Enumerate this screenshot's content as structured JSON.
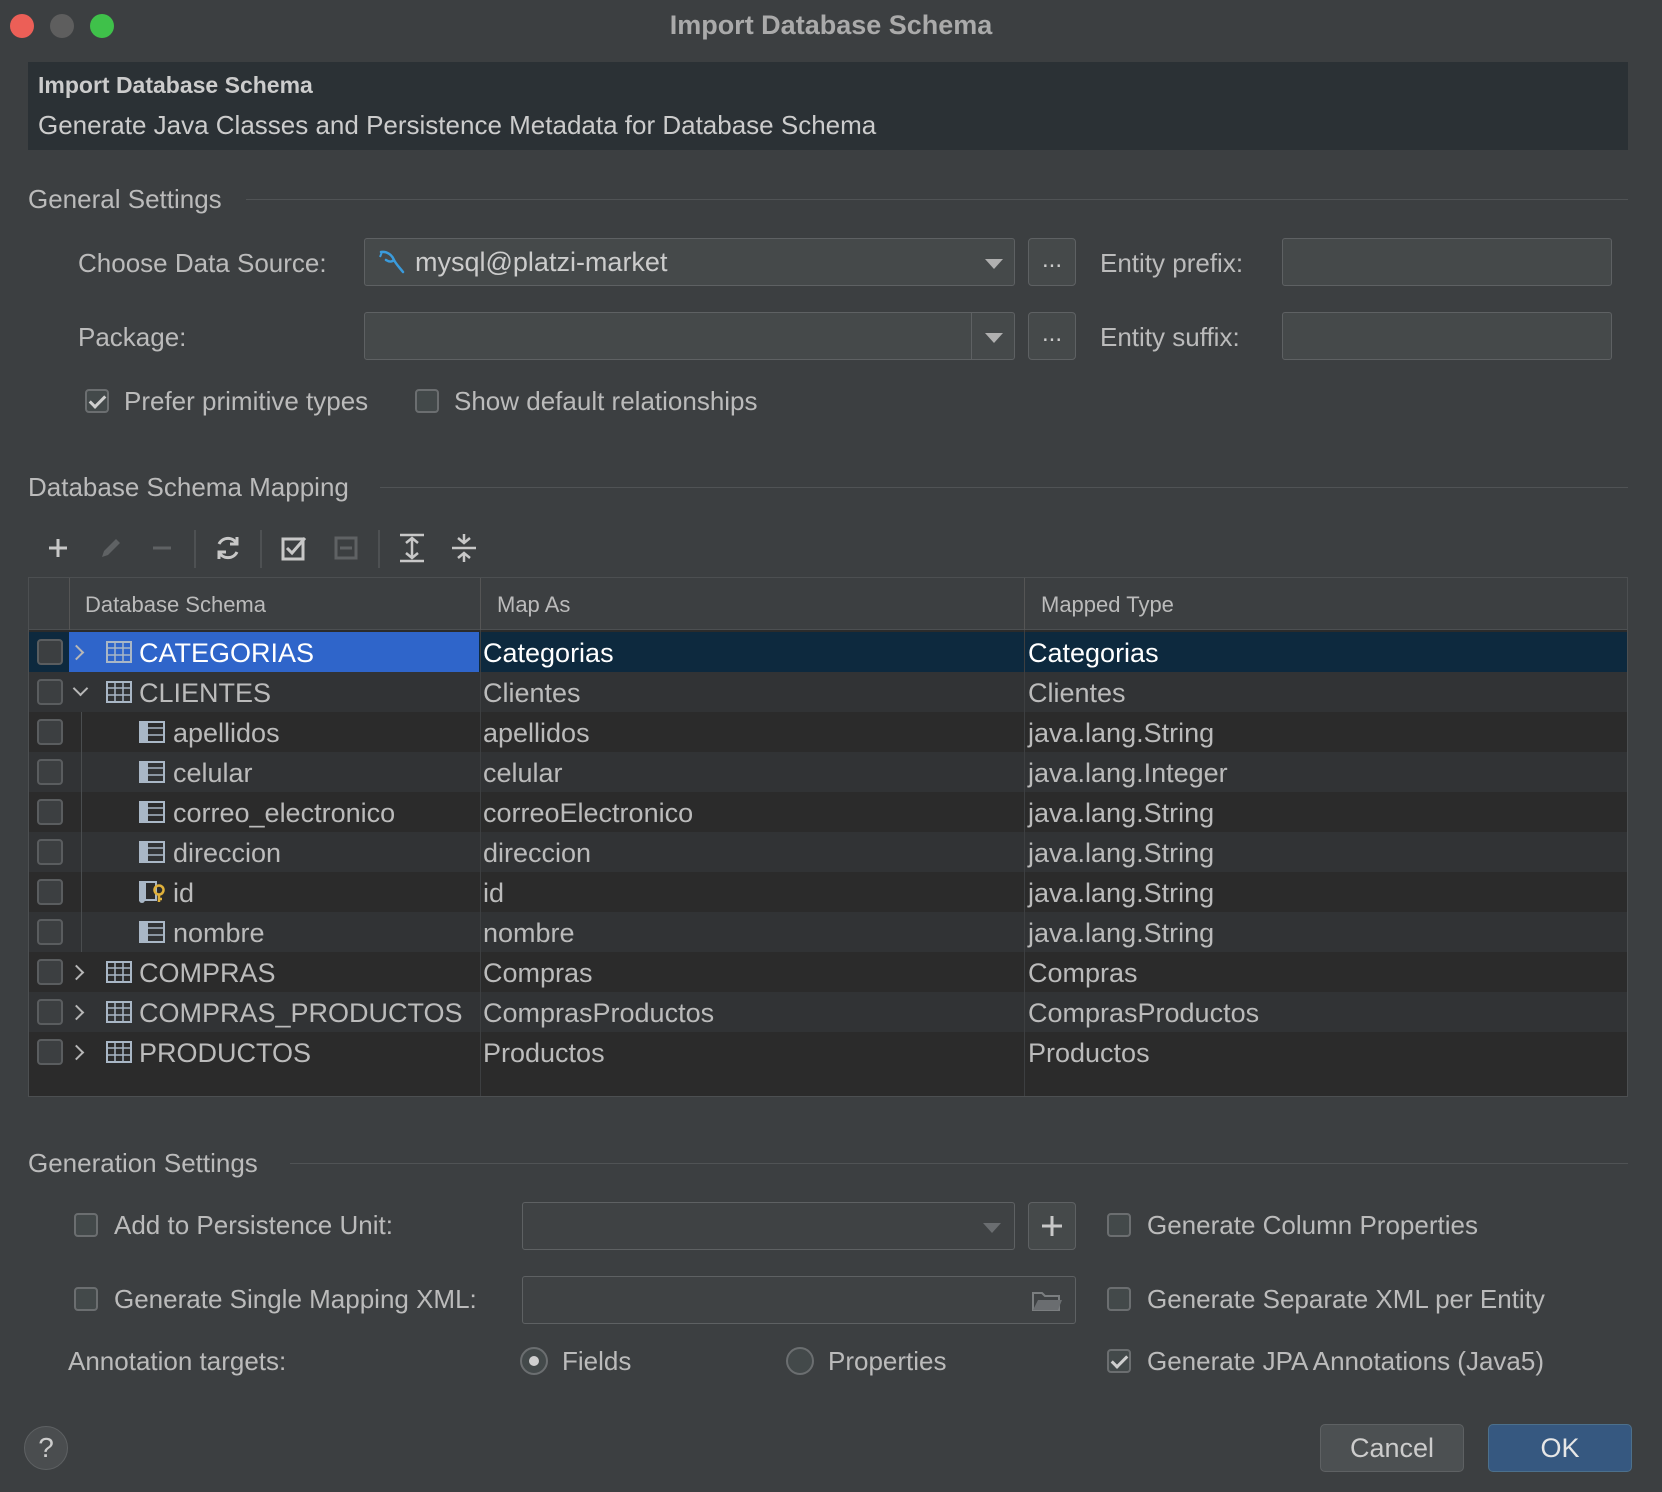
{
  "window": {
    "title": "Import Database Schema"
  },
  "header": {
    "title": "Import Database Schema",
    "subtitle": "Generate Java Classes and Persistence Metadata for Database Schema"
  },
  "general": {
    "section_label": "General Settings",
    "data_source_label": "Choose Data Source:",
    "data_source_value": "mysql@platzi-market",
    "package_label": "Package:",
    "package_value": "",
    "ellipsis": "...",
    "entity_prefix_label": "Entity prefix:",
    "entity_prefix_value": "",
    "entity_suffix_label": "Entity suffix:",
    "entity_suffix_value": "",
    "prefer_primitive_label": "Prefer primitive types",
    "prefer_primitive_checked": true,
    "show_default_rel_label": "Show default relationships",
    "show_default_rel_checked": false
  },
  "mapping": {
    "section_label": "Database Schema Mapping",
    "toolbar": [
      "add-icon",
      "edit-icon",
      "remove-icon",
      "refresh-icon",
      "check-all-icon",
      "uncheck-all-icon",
      "expand-all-icon",
      "collapse-all-icon"
    ],
    "columns": [
      "Database Schema",
      "Map As",
      "Mapped Type"
    ],
    "rows": [
      {
        "name": "CATEGORIAS",
        "map_as": "Categorias",
        "type": "Categorias",
        "kind": "table",
        "state": "collapsed",
        "selected": true
      },
      {
        "name": "CLIENTES",
        "map_as": "Clientes",
        "type": "Clientes",
        "kind": "table",
        "state": "expanded"
      },
      {
        "name": "apellidos",
        "map_as": "apellidos",
        "type": "java.lang.String",
        "kind": "column"
      },
      {
        "name": "celular",
        "map_as": "celular",
        "type": "java.lang.Integer",
        "kind": "column"
      },
      {
        "name": "correo_electronico",
        "map_as": "correoElectronico",
        "type": "java.lang.String",
        "kind": "column"
      },
      {
        "name": "direccion",
        "map_as": "direccion",
        "type": "java.lang.String",
        "kind": "column"
      },
      {
        "name": "id",
        "map_as": "id",
        "type": "java.lang.String",
        "kind": "key"
      },
      {
        "name": "nombre",
        "map_as": "nombre",
        "type": "java.lang.String",
        "kind": "column"
      },
      {
        "name": "COMPRAS",
        "map_as": "Compras",
        "type": "Compras",
        "kind": "table",
        "state": "collapsed"
      },
      {
        "name": "COMPRAS_PRODUCTOS",
        "map_as": "ComprasProductos",
        "type": "ComprasProductos",
        "kind": "table",
        "state": "collapsed"
      },
      {
        "name": "PRODUCTOS",
        "map_as": "Productos",
        "type": "Productos",
        "kind": "table",
        "state": "collapsed"
      }
    ]
  },
  "generation": {
    "section_label": "Generation Settings",
    "add_persistence_label": "Add to Persistence Unit:",
    "add_persistence_checked": false,
    "add_persistence_value": "",
    "single_xml_label": "Generate Single Mapping XML:",
    "single_xml_checked": false,
    "single_xml_value": "",
    "annotation_targets_label": "Annotation targets:",
    "fields_label": "Fields",
    "fields_selected": true,
    "properties_label": "Properties",
    "properties_selected": false,
    "column_props_label": "Generate Column Properties",
    "column_props_checked": false,
    "separate_xml_label": "Generate Separate XML per Entity",
    "separate_xml_checked": false,
    "jpa_annotations_label": "Generate JPA Annotations (Java5)",
    "jpa_annotations_checked": true
  },
  "footer": {
    "help": "?",
    "cancel": "Cancel",
    "ok": "OK"
  },
  "colors": {
    "accent": "#2f65ca",
    "ok_button": "#365880",
    "selected_row": "#0d293e"
  }
}
